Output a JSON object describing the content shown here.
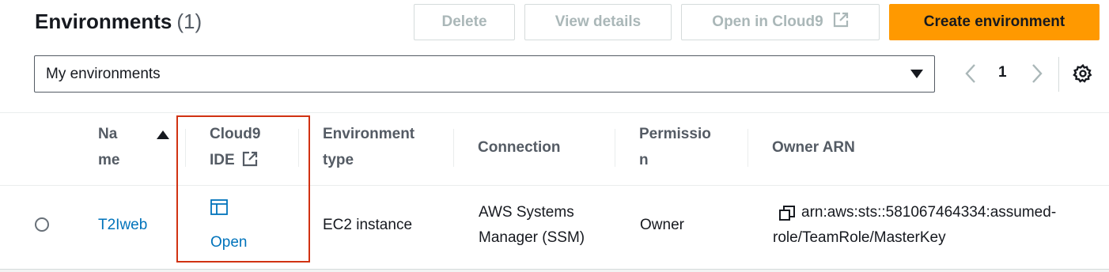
{
  "header": {
    "title": "Environments",
    "count": "(1)"
  },
  "actions": {
    "delete_label": "Delete",
    "view_details_label": "View details",
    "open_cloud9_label": "Open in Cloud9",
    "create_label": "Create environment"
  },
  "filter": {
    "selected": "My environments"
  },
  "pagination": {
    "current_page": "1"
  },
  "table": {
    "columns": {
      "name": "Name",
      "ide": "Cloud9 IDE",
      "env_type": "Environment type",
      "connection": "Connection",
      "permission": "Permission",
      "owner_arn": "Owner ARN"
    },
    "rows": [
      {
        "name": "T2Iweb",
        "ide_link": "Open",
        "env_type": "EC2 instance",
        "connection_line1": "AWS Systems",
        "connection_line2": "Manager (SSM)",
        "permission": "Owner",
        "owner_arn_line1": "arn:aws:sts::581067464334:assumed-",
        "owner_arn_line2": "role/TeamRole/MasterKey"
      }
    ]
  },
  "colors": {
    "primary": "#ff9900",
    "link": "#0073bb",
    "highlight": "#d13212"
  }
}
